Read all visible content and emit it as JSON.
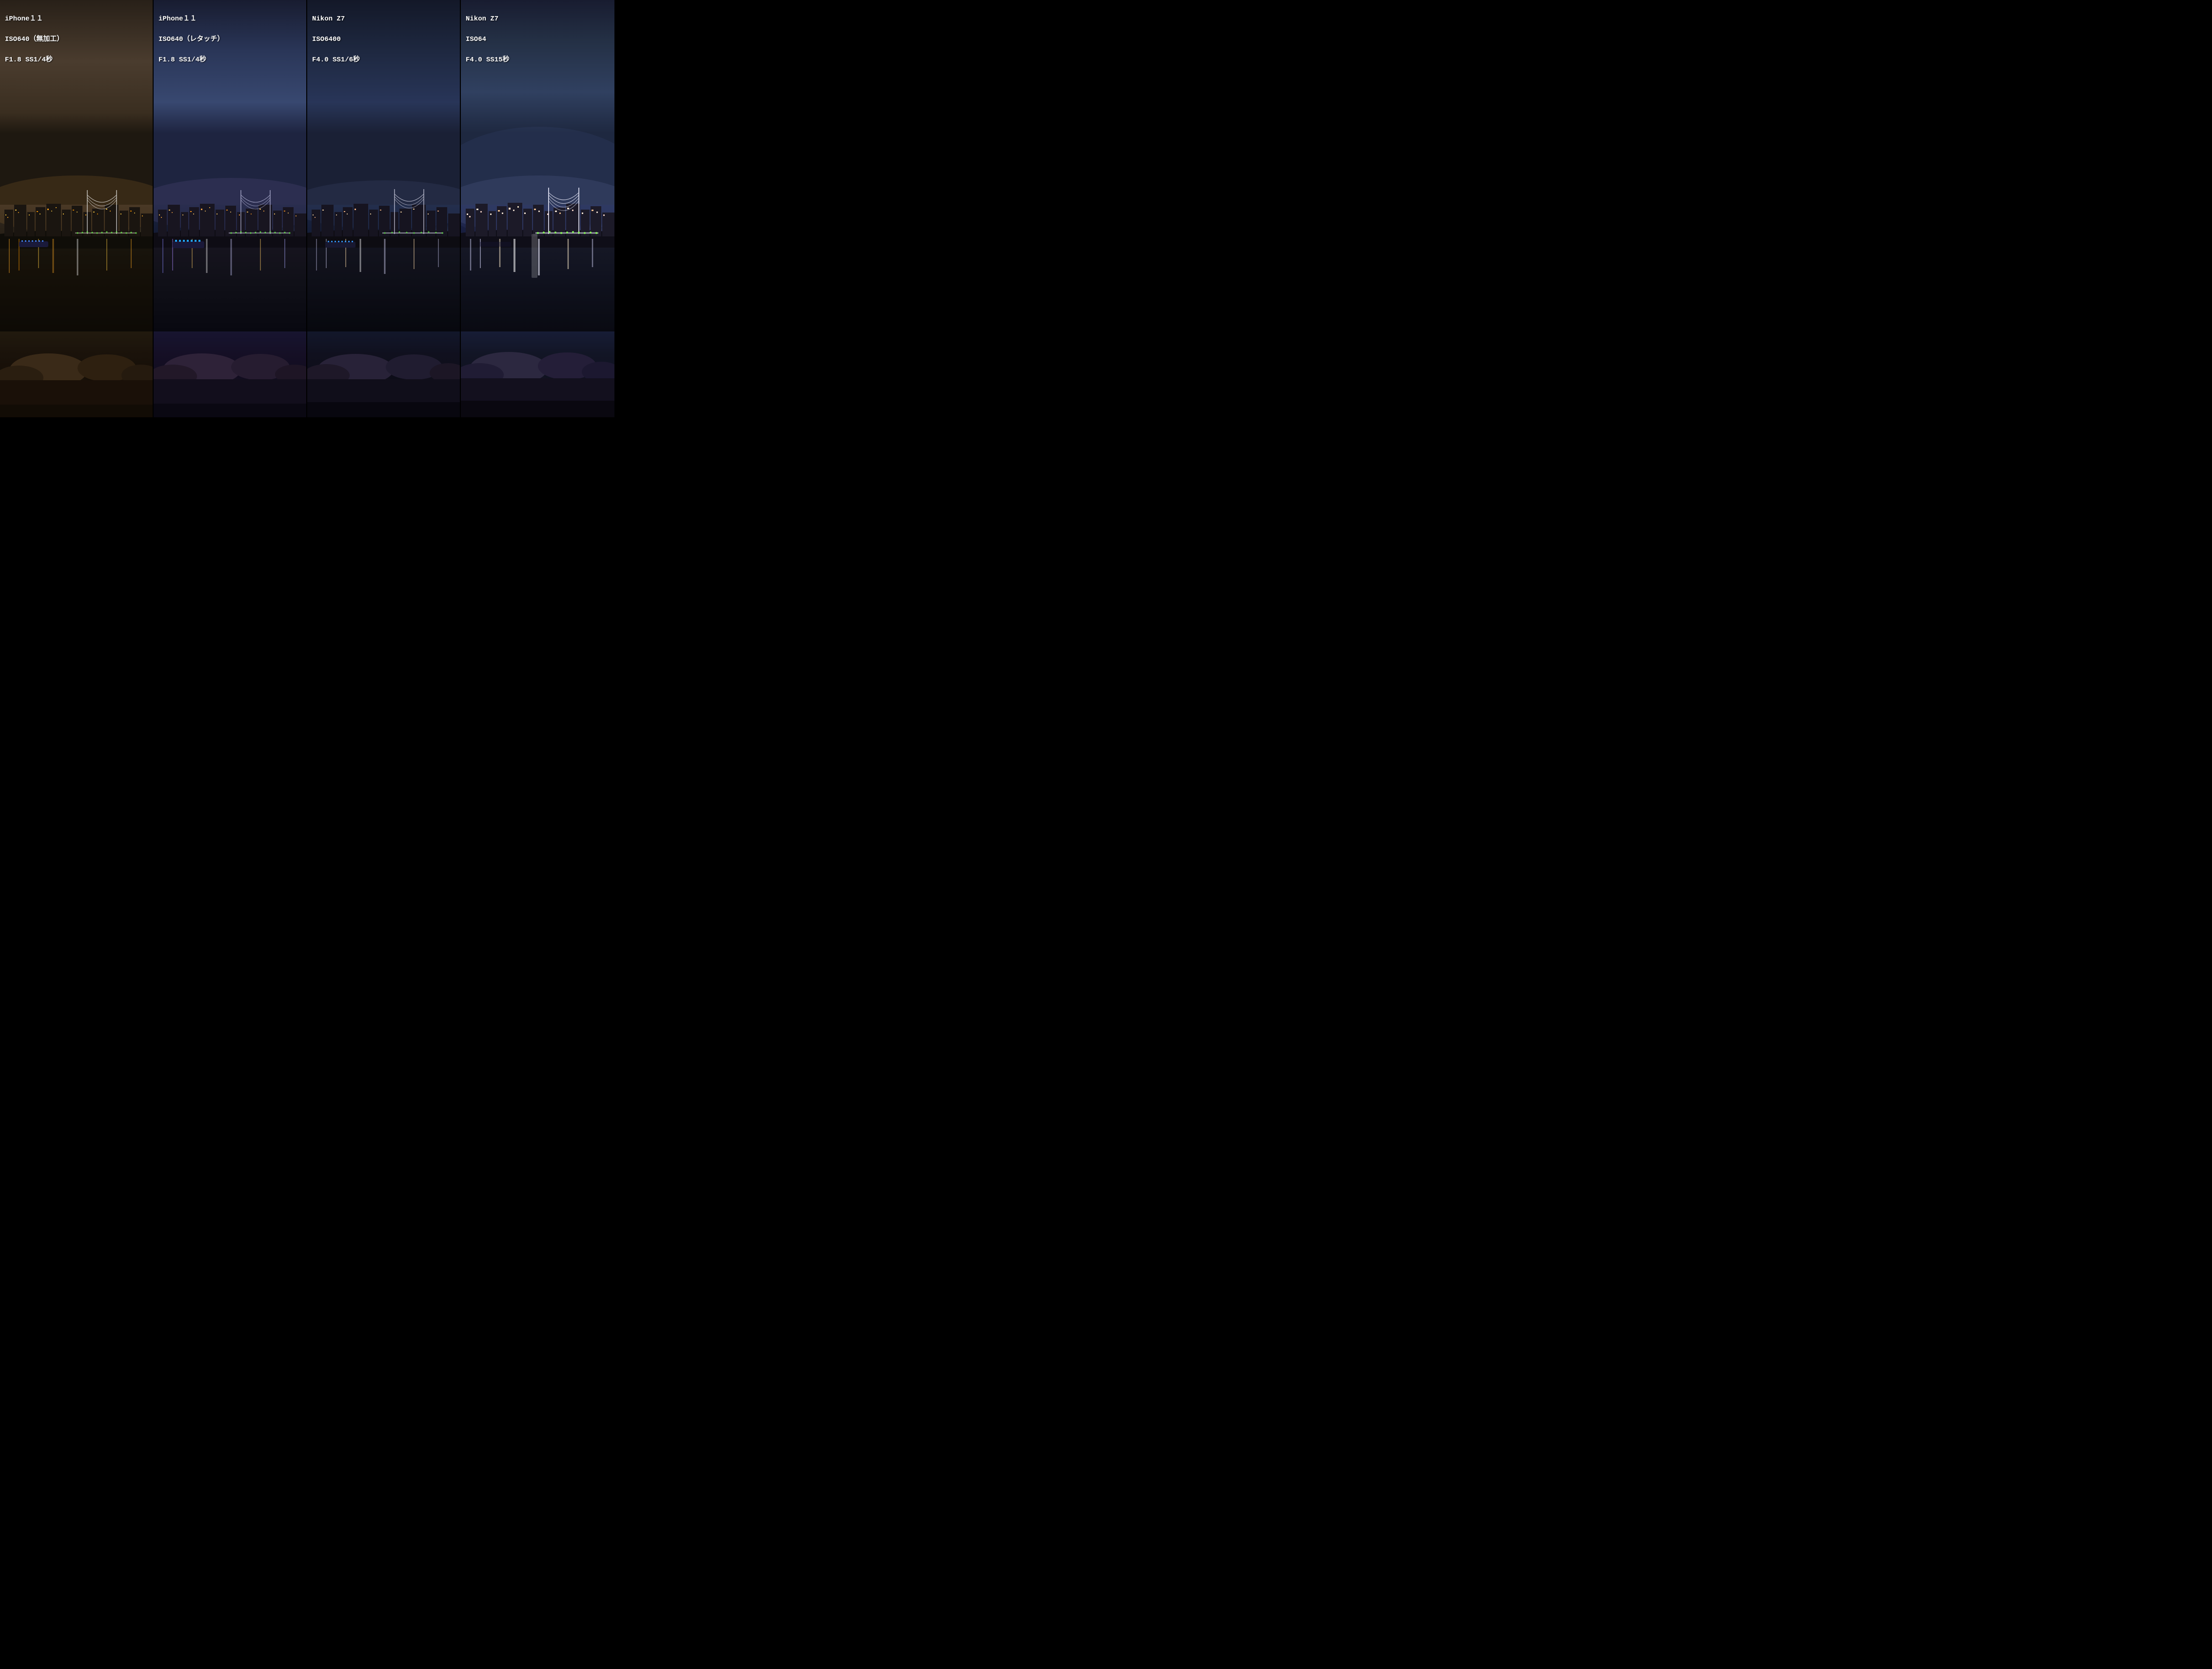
{
  "panels": [
    {
      "id": "panel-1",
      "label_line1": "iPhone１１",
      "label_line2": "ISO640（無加工）",
      "label_line3": "F1.8 SS1/4秒",
      "sky_color_top": "#2a2420",
      "sky_color_mid": "#4a3e32",
      "theme": "warm"
    },
    {
      "id": "panel-2",
      "label_line1": "iPhone１１",
      "label_line2": "ISO640（レタッチ）",
      "label_line3": "F1.8 SS1/4秒",
      "sky_color_top": "#1a1f35",
      "sky_color_mid": "#3a4570",
      "theme": "cool-blue"
    },
    {
      "id": "panel-3",
      "label_line1": "Nikon Z7",
      "label_line2": "ISO6400",
      "label_line3": "F4.0 SS1/6秒",
      "sky_color_top": "#151828",
      "sky_color_mid": "#2a3858",
      "theme": "blue"
    },
    {
      "id": "panel-4",
      "label_line1": "Nikon Z7",
      "label_line2": "ISO64",
      "label_line3": "F4.0 SS15秒",
      "sky_color_top": "#1c2035",
      "sky_color_mid": "#303d62",
      "theme": "blue-bright"
    }
  ]
}
